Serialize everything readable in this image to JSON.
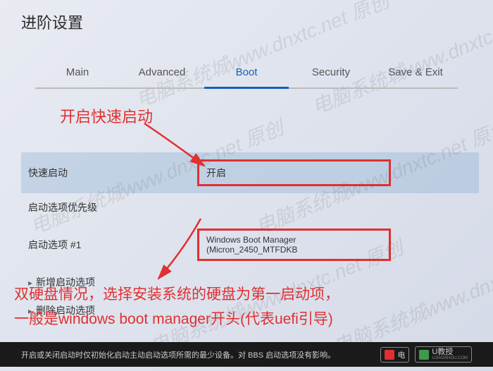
{
  "title": "进阶设置",
  "tabs": [
    {
      "label": "Main"
    },
    {
      "label": "Advanced"
    },
    {
      "label": "Boot"
    },
    {
      "label": "Security"
    },
    {
      "label": "Save & Exit"
    }
  ],
  "annotations": {
    "fast_boot": "开启快速启动",
    "dual_disk_line1": "双硬盘情况，选择安装系统的硬盘为第一启动项，",
    "dual_disk_line2": "一般是windows boot manager开头(代表uefi引导)"
  },
  "settings": {
    "fast_boot": {
      "label": "快速启动",
      "value": "开启"
    },
    "boot_priority": {
      "label": "启动选项优先级"
    },
    "boot_option_1": {
      "label": "启动选项 #1",
      "value": "Windows Boot Manager (Micron_2450_MTFDKB"
    },
    "add_boot": {
      "label": "新增启动选项"
    },
    "delete_boot": {
      "label": "删除启动选项"
    }
  },
  "footer": "开启或关闭启动时仅初始化启动主动启动选项所需的最少设备。对 BBS 启动选项没有影响。",
  "watermarks": {
    "text": "电脑系统城www.dnxtc.net 原创"
  },
  "logos": {
    "logo1": "电",
    "logo2": "U教授",
    "logo2_sub": "UJIAOSHOU.COM"
  }
}
